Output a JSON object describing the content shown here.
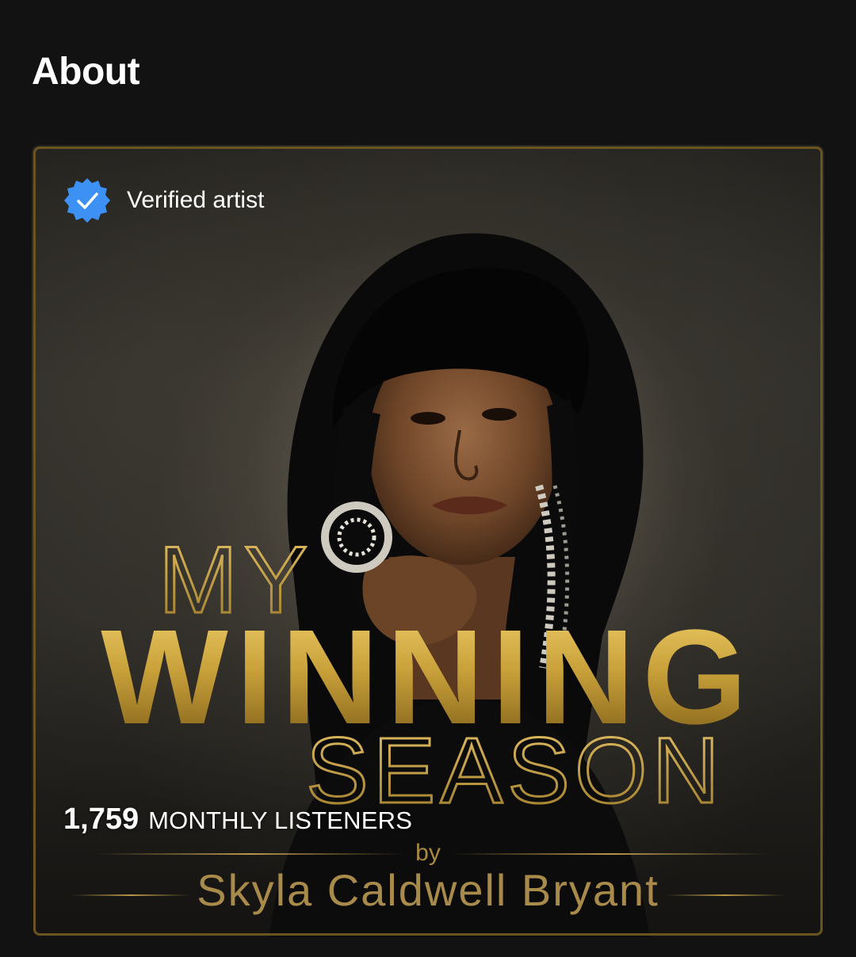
{
  "section": {
    "title": "About"
  },
  "card": {
    "verified_label": "Verified artist",
    "monthly_listeners_count": "1,759",
    "monthly_listeners_label": "MONTHLY LISTENERS",
    "artwork_text": {
      "line_my": "MY",
      "line_winning": "WINNING",
      "line_season": "SEASON",
      "line_by": "by",
      "line_artist": "Skyla Caldwell Bryant"
    }
  },
  "icons": {
    "verified": "verified-badge-icon"
  },
  "colors": {
    "background": "#121212",
    "verified_blue": "#3D91F4",
    "gold": "#C9A13A",
    "gold_dark": "#8A6A1E"
  }
}
